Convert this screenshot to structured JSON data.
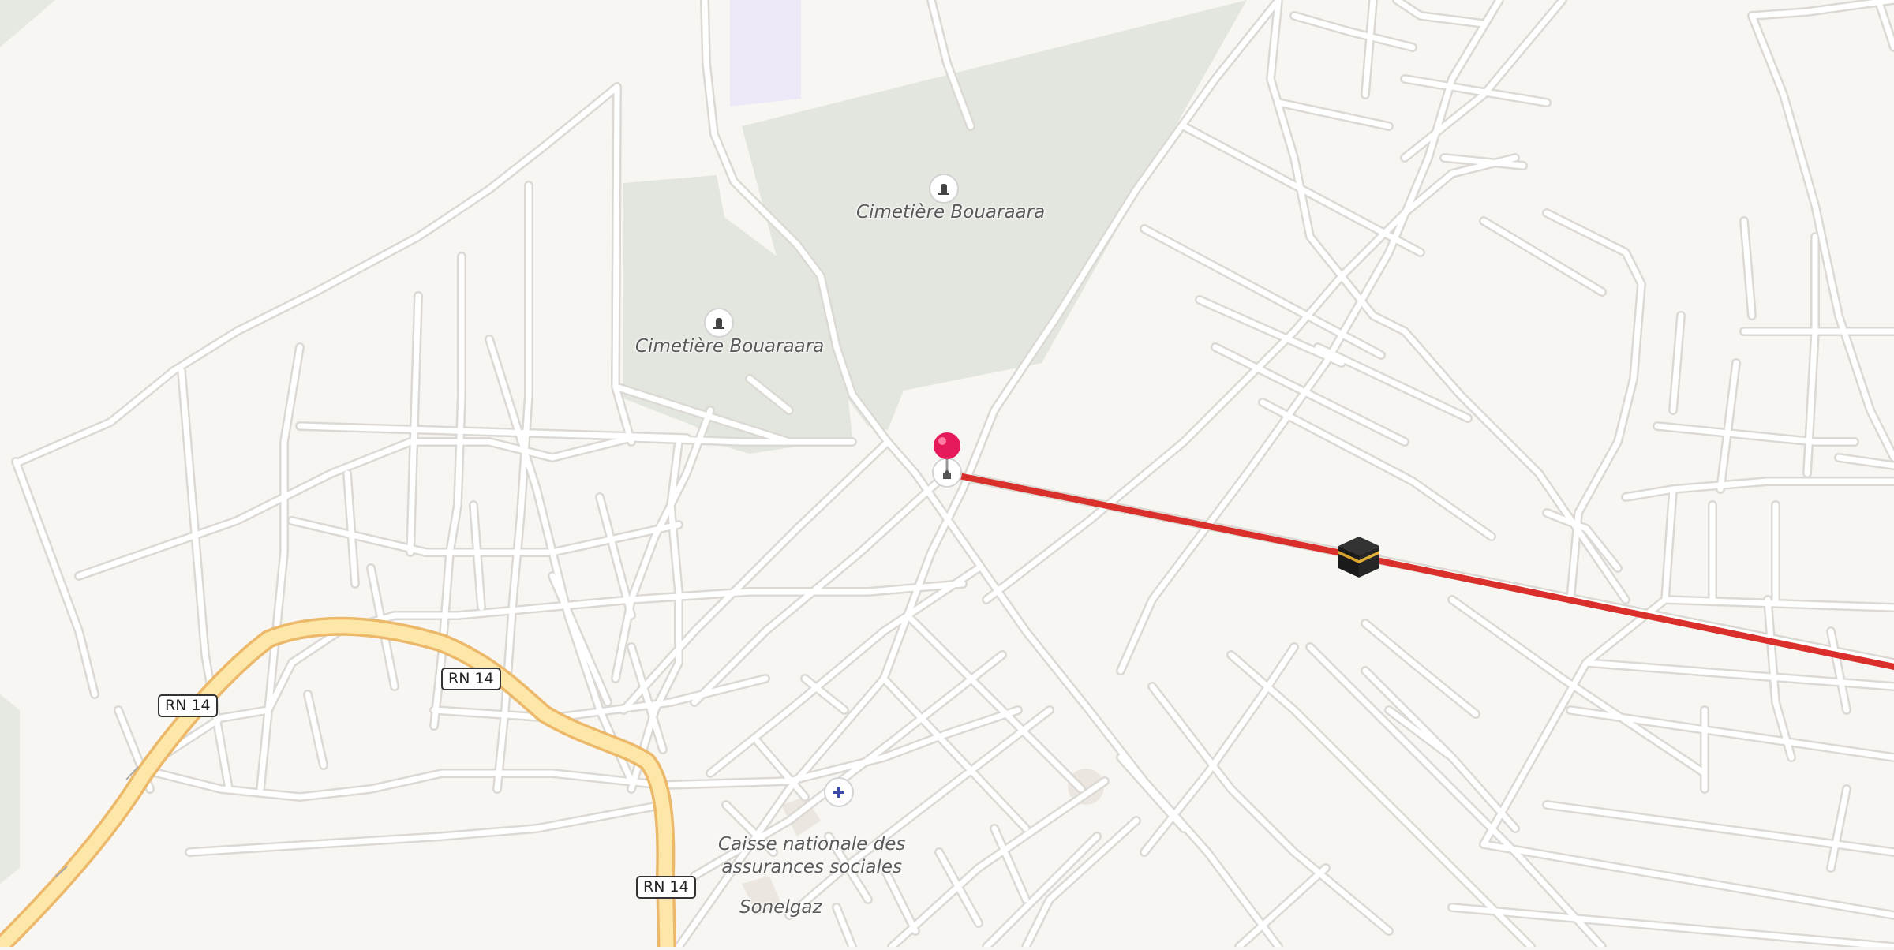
{
  "map": {
    "labels": {
      "cemetery_north": "Cimetière Bouaraara",
      "cemetery_west": "Cimetière Bouaraara",
      "cnas": "Caisse nationale des\nassurances sociales",
      "sonelgaz": "Sonelgaz"
    },
    "road_shields": [
      "RN 14",
      "RN 14",
      "RN 14"
    ],
    "icons": {
      "cemetery": "cemetery-icon",
      "pharmacy": "pharmacy-icon",
      "mosque": "mosque-icon",
      "kaaba": "kaaba-icon",
      "pin": "location-pin-icon"
    },
    "colors": {
      "background": "#f8f6f2",
      "streets": "#ffffff",
      "street_casing": "#dcd9d4",
      "highway": "#fde7a8",
      "highway_casing": "#ecb86a",
      "cemetery": "#e3e6df",
      "route": "#d9302c",
      "pin": "#e6195a"
    }
  }
}
